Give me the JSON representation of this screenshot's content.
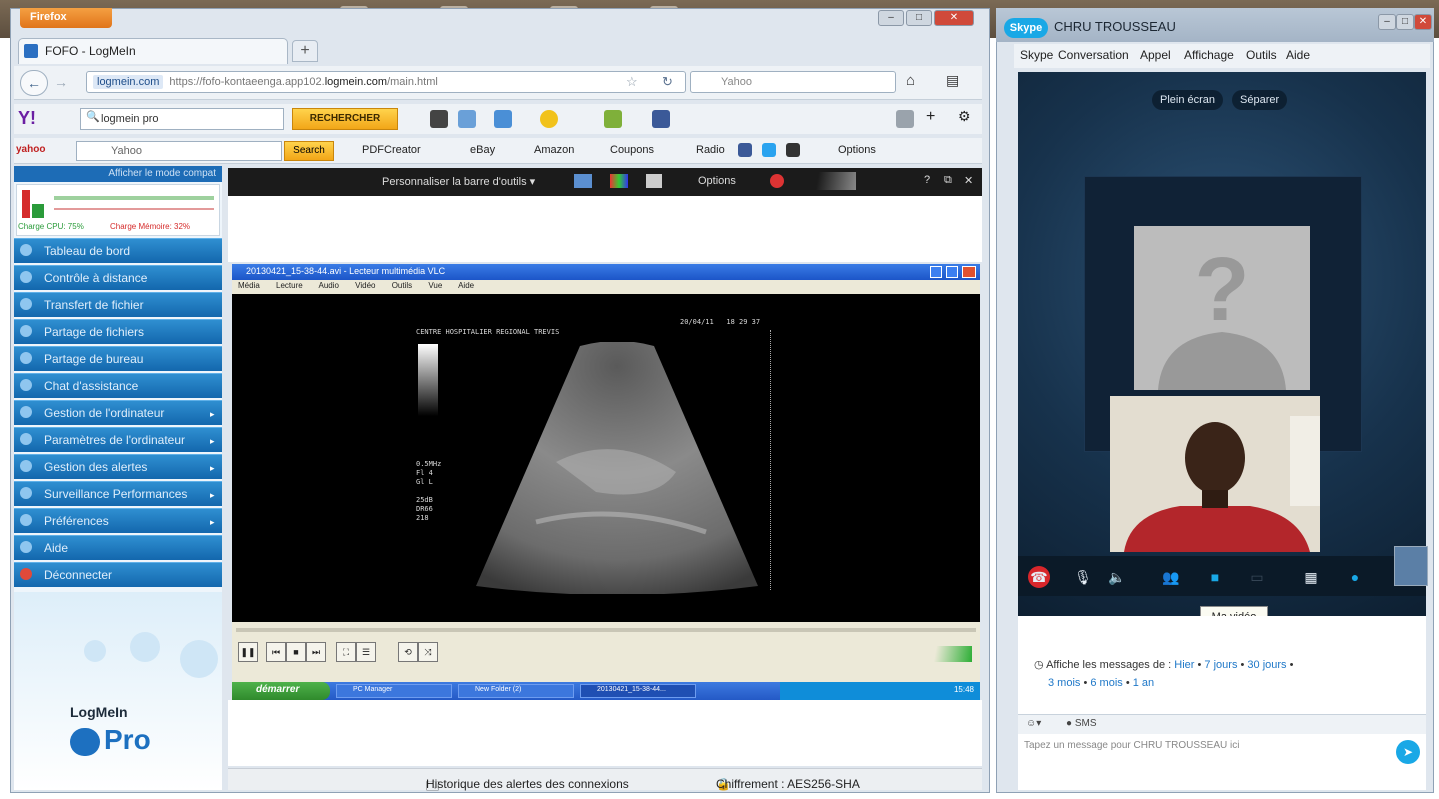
{
  "firefox": {
    "menu_button": "Firefox",
    "tab_title": "FOFO - LogMeIn",
    "new_tab": "+",
    "url_site": "logmein.com",
    "url_prefix": "https://fofo-kontaeenga.app102.",
    "url_host": "logmein.com",
    "url_suffix": "/main.html",
    "search_engine": "Yahoo",
    "yahoo_search_value": "logmein pro",
    "yahoo_search_button": "RECHERCHER",
    "bookmarks": {
      "yahoo_placeholder": "Yahoo",
      "search_button": "Search",
      "items": [
        "PDFCreator",
        "eBay",
        "Amazon",
        "Coupons",
        "Radio",
        "Options"
      ]
    }
  },
  "logmein": {
    "compat_mode": "Afficher le mode compat",
    "perf_cpu": "Charge CPU: 75%",
    "perf_mem": "Charge Mémoire: 32%",
    "menu": [
      "Tableau de bord",
      "Contrôle à distance",
      "Transfert de fichier",
      "Partage de fichiers",
      "Partage de bureau",
      "Chat d'assistance",
      "Gestion de l'ordinateur",
      "Paramètres de l'ordinateur",
      "Gestion des alertes",
      "Surveillance Performances",
      "Préférences",
      "Aide",
      "Déconnecter"
    ],
    "logo_text": "LogMeIn",
    "logo_pro": "Pro",
    "remote_toolbar": {
      "customize": "Personnaliser la barre d'outils",
      "options": "Options"
    },
    "status": {
      "history": "Historique des alertes des connexions",
      "encryption": "Chiffrement : AES256-SHA"
    }
  },
  "remote": {
    "vlc_title": "20130421_15-38-44.avi - Lecteur multimédia VLC",
    "vlc_menu": "Média Lecture Audio Vidéo Outils Vue Aide",
    "us_header": "CENTRE HOSPITALIER REGIONAL TREVIS",
    "us_date": "20/04/11   18 29 37",
    "us_params": "0.5MHz\nFl 4\nGl L\n\n25dB\nDR66\n218",
    "taskbar": {
      "start": "démarrer",
      "tasks": [
        "PC Manager",
        "New Folder (2)",
        "20130421_15-38-44..."
      ],
      "clock": "15:48"
    }
  },
  "skype": {
    "window_title": "CHRU TROUSSEAU",
    "logo": "Skype",
    "menu": [
      "Skype",
      "Conversation",
      "Appel",
      "Affichage",
      "Outils",
      "Aide"
    ],
    "fullscreen": "Plein écran",
    "separate": "Séparer",
    "tooltip": "Ma vidéo",
    "history_prefix": "Affiche les messages de :",
    "history_links": [
      "Hier",
      "7 jours",
      "30 jours",
      "3 mois",
      "6 mois",
      "1 an"
    ],
    "sms_label": "SMS",
    "input_placeholder": "Tapez un message pour CHRU TROUSSEAU ici"
  }
}
